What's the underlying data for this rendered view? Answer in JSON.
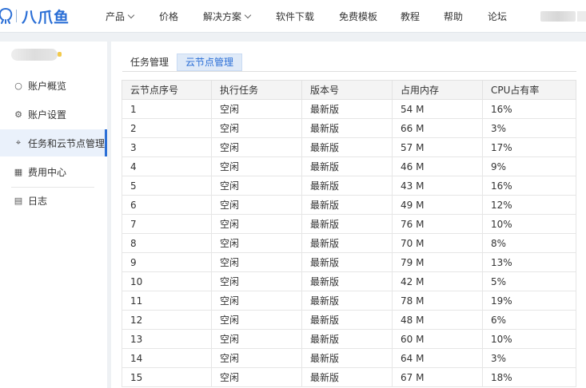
{
  "brand": {
    "name": "八爪鱼"
  },
  "nav": [
    {
      "label": "产品",
      "dropdown": true
    },
    {
      "label": "价格",
      "dropdown": false
    },
    {
      "label": "解决方案",
      "dropdown": true
    },
    {
      "label": "软件下载",
      "dropdown": false
    },
    {
      "label": "免费模板",
      "dropdown": false
    },
    {
      "label": "教程",
      "dropdown": false
    },
    {
      "label": "帮助",
      "dropdown": false
    },
    {
      "label": "论坛",
      "dropdown": false
    }
  ],
  "sidebar": {
    "items": [
      {
        "label": "账户概览",
        "icon": "user-icon",
        "active": false
      },
      {
        "label": "账户设置",
        "icon": "gear-icon",
        "active": false
      },
      {
        "label": "任务和云节点管理",
        "icon": "network-icon",
        "active": true
      },
      {
        "label": "费用中心",
        "icon": "card-icon",
        "active": false
      },
      {
        "label": "日志",
        "icon": "log-icon",
        "active": false
      }
    ]
  },
  "tabs": [
    {
      "label": "任务管理",
      "active": false
    },
    {
      "label": "云节点管理",
      "active": true
    }
  ],
  "table": {
    "headers": [
      "云节点序号",
      "执行任务",
      "版本号",
      "占用内存",
      "CPU占有率"
    ],
    "rows": [
      [
        "1",
        "空闲",
        "最新版",
        "54 M",
        "16%"
      ],
      [
        "2",
        "空闲",
        "最新版",
        "66 M",
        "3%"
      ],
      [
        "3",
        "空闲",
        "最新版",
        "57 M",
        "17%"
      ],
      [
        "4",
        "空闲",
        "最新版",
        "46 M",
        "9%"
      ],
      [
        "5",
        "空闲",
        "最新版",
        "43 M",
        "16%"
      ],
      [
        "6",
        "空闲",
        "最新版",
        "49 M",
        "12%"
      ],
      [
        "7",
        "空闲",
        "最新版",
        "76 M",
        "10%"
      ],
      [
        "8",
        "空闲",
        "最新版",
        "70 M",
        "8%"
      ],
      [
        "9",
        "空闲",
        "最新版",
        "79 M",
        "13%"
      ],
      [
        "10",
        "空闲",
        "最新版",
        "42 M",
        "5%"
      ],
      [
        "11",
        "空闲",
        "最新版",
        "78 M",
        "19%"
      ],
      [
        "12",
        "空闲",
        "最新版",
        "48 M",
        "6%"
      ],
      [
        "13",
        "空闲",
        "最新版",
        "60 M",
        "10%"
      ],
      [
        "14",
        "空闲",
        "最新版",
        "64 M",
        "3%"
      ],
      [
        "15",
        "空闲",
        "最新版",
        "67 M",
        "18%"
      ]
    ]
  },
  "colors": {
    "accent": "#2b6fd6",
    "active_bg": "#eaf1fb"
  }
}
